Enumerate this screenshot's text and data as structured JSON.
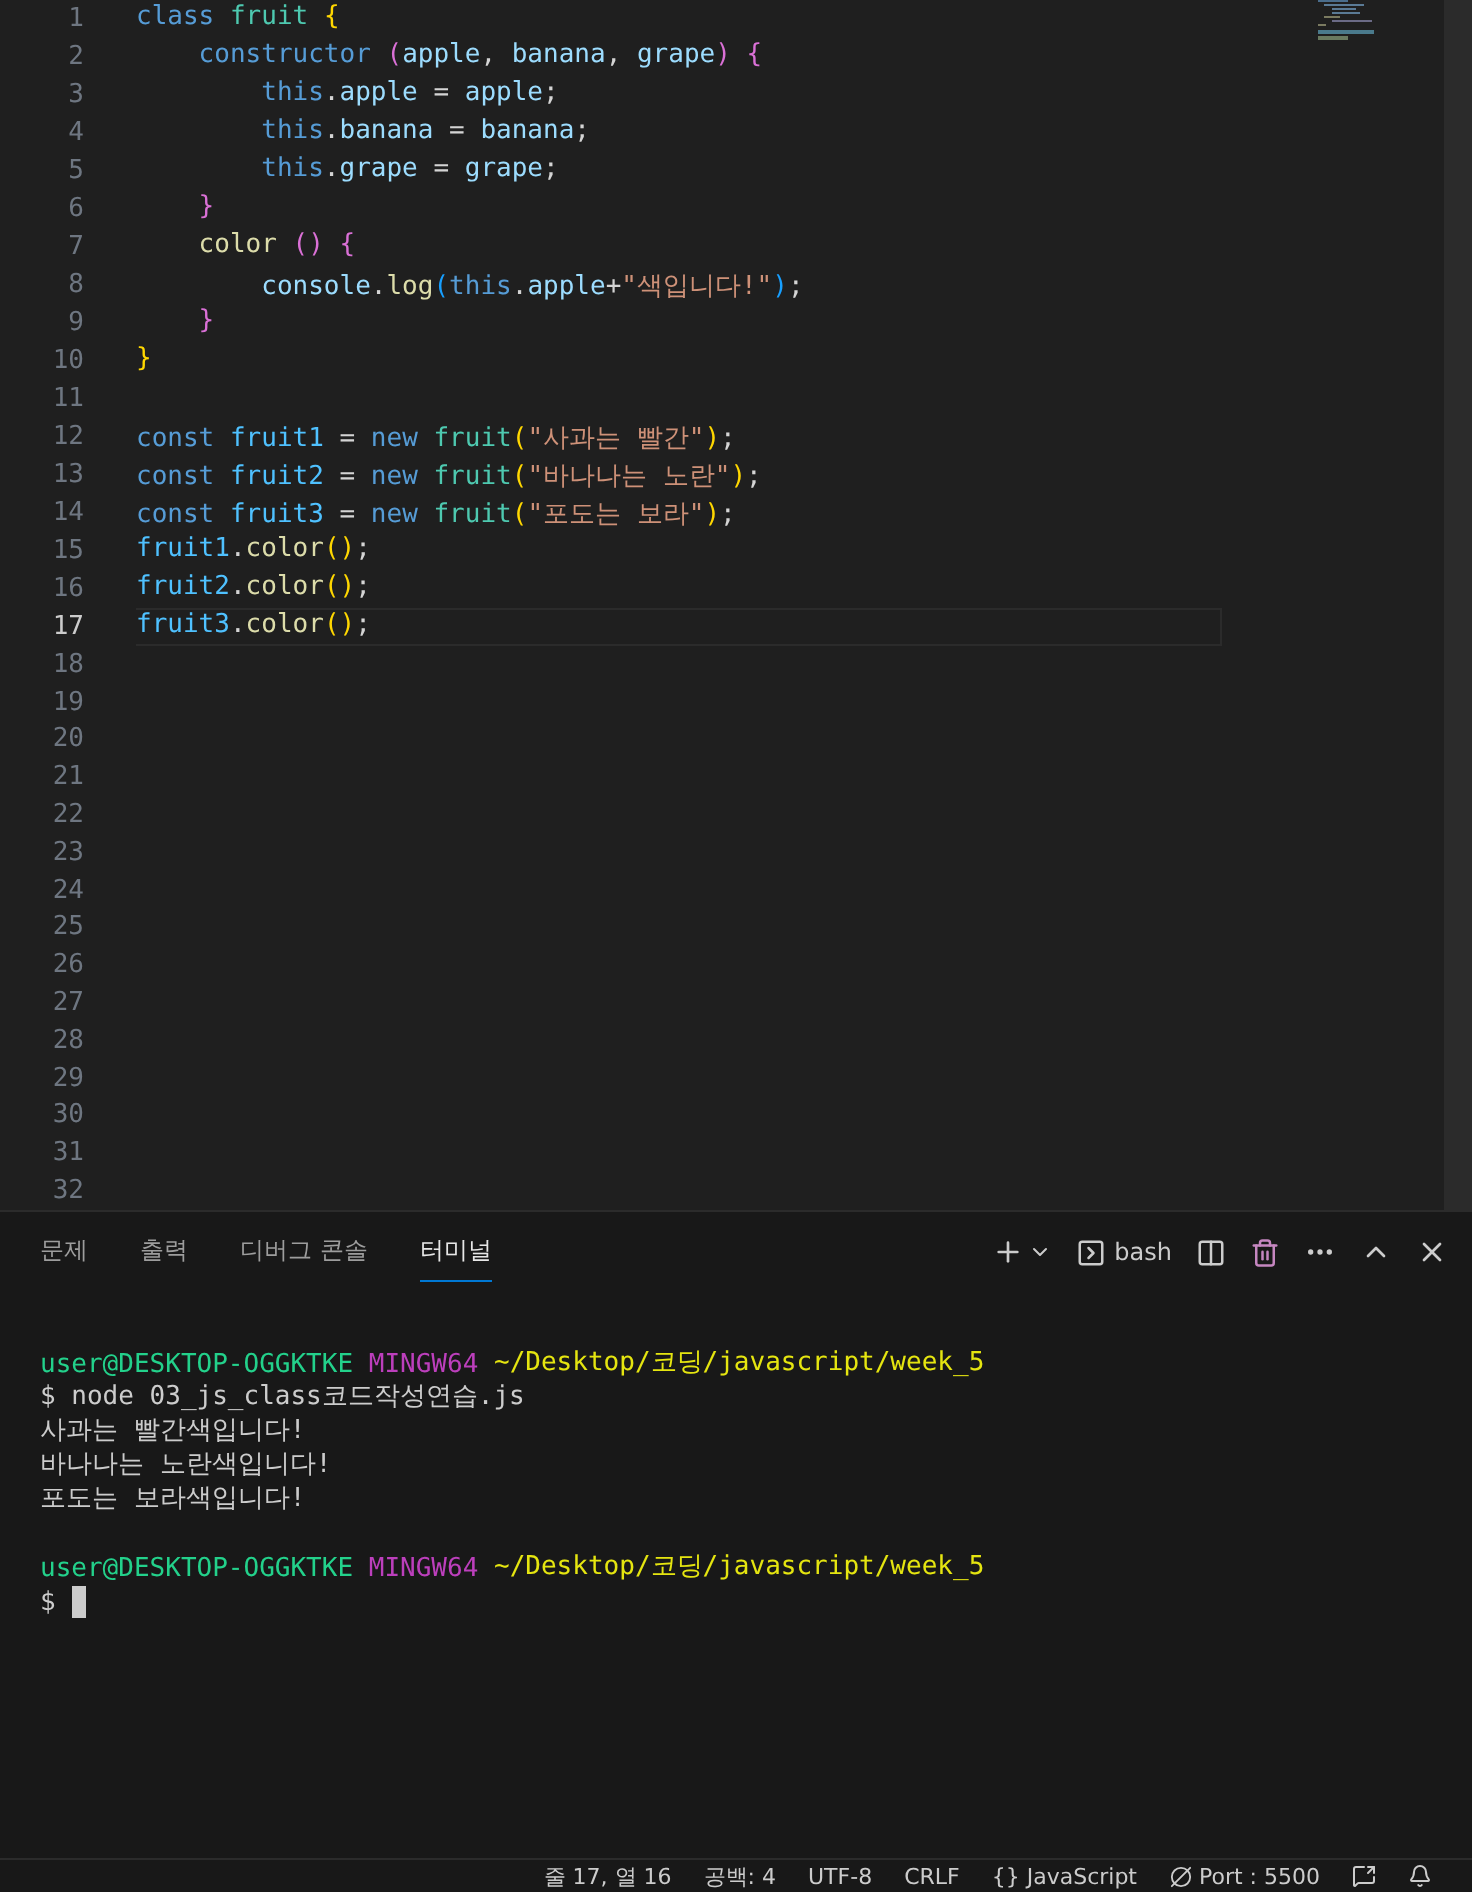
{
  "editor": {
    "lines": [
      {
        "number": "1",
        "active": false,
        "tokens": [
          {
            "kind": "keyword",
            "text": "class "
          },
          {
            "kind": "type",
            "text": "fruit "
          },
          {
            "kind": "bracket1",
            "text": "{"
          }
        ]
      },
      {
        "number": "2",
        "active": false,
        "tokens": [
          {
            "kind": "keyword",
            "text": "    constructor "
          },
          {
            "kind": "bracket2",
            "text": "("
          },
          {
            "kind": "variable",
            "text": "apple"
          },
          {
            "kind": "plain",
            "text": ", "
          },
          {
            "kind": "variable",
            "text": "banana"
          },
          {
            "kind": "plain",
            "text": ", "
          },
          {
            "kind": "variable",
            "text": "grape"
          },
          {
            "kind": "bracket2",
            "text": ") "
          },
          {
            "kind": "bracket2",
            "text": "{"
          }
        ]
      },
      {
        "number": "3",
        "active": false,
        "tokens": [
          {
            "kind": "keyword",
            "text": "        this"
          },
          {
            "kind": "plain",
            "text": "."
          },
          {
            "kind": "variable",
            "text": "apple"
          },
          {
            "kind": "plain",
            "text": " = "
          },
          {
            "kind": "variable",
            "text": "apple"
          },
          {
            "kind": "plain",
            "text": ";"
          }
        ]
      },
      {
        "number": "4",
        "active": false,
        "tokens": [
          {
            "kind": "keyword",
            "text": "        this"
          },
          {
            "kind": "plain",
            "text": "."
          },
          {
            "kind": "variable",
            "text": "banana"
          },
          {
            "kind": "plain",
            "text": " = "
          },
          {
            "kind": "variable",
            "text": "banana"
          },
          {
            "kind": "plain",
            "text": ";"
          }
        ]
      },
      {
        "number": "5",
        "active": false,
        "tokens": [
          {
            "kind": "keyword",
            "text": "        this"
          },
          {
            "kind": "plain",
            "text": "."
          },
          {
            "kind": "variable",
            "text": "grape"
          },
          {
            "kind": "plain",
            "text": " = "
          },
          {
            "kind": "variable",
            "text": "grape"
          },
          {
            "kind": "plain",
            "text": ";"
          }
        ]
      },
      {
        "number": "6",
        "active": false,
        "tokens": [
          {
            "kind": "bracket2",
            "text": "    }"
          }
        ]
      },
      {
        "number": "7",
        "active": false,
        "tokens": [
          {
            "kind": "function",
            "text": "    color "
          },
          {
            "kind": "bracket2",
            "text": "() "
          },
          {
            "kind": "bracket2",
            "text": "{"
          }
        ]
      },
      {
        "number": "8",
        "active": false,
        "tokens": [
          {
            "kind": "variable",
            "text": "        console"
          },
          {
            "kind": "plain",
            "text": "."
          },
          {
            "kind": "function",
            "text": "log"
          },
          {
            "kind": "bracket3",
            "text": "("
          },
          {
            "kind": "keyword",
            "text": "this"
          },
          {
            "kind": "plain",
            "text": "."
          },
          {
            "kind": "variable",
            "text": "apple"
          },
          {
            "kind": "plain",
            "text": "+"
          },
          {
            "kind": "string",
            "text": "\"색입니다!\""
          },
          {
            "kind": "bracket3",
            "text": ")"
          },
          {
            "kind": "plain",
            "text": ";"
          }
        ]
      },
      {
        "number": "9",
        "active": false,
        "tokens": [
          {
            "kind": "bracket2",
            "text": "    }"
          }
        ]
      },
      {
        "number": "10",
        "active": false,
        "tokens": [
          {
            "kind": "bracket1",
            "text": "}"
          }
        ]
      },
      {
        "number": "11",
        "active": false
      },
      {
        "number": "12",
        "active": false,
        "tokens": [
          {
            "kind": "keyword",
            "text": "const "
          },
          {
            "kind": "constant",
            "text": "fruit1"
          },
          {
            "kind": "plain",
            "text": " = "
          },
          {
            "kind": "keyword",
            "text": "new "
          },
          {
            "kind": "type",
            "text": "fruit"
          },
          {
            "kind": "bracket1",
            "text": "("
          },
          {
            "kind": "string",
            "text": "\"사과는 빨간\""
          },
          {
            "kind": "bracket1",
            "text": ")"
          },
          {
            "kind": "plain",
            "text": ";"
          }
        ]
      },
      {
        "number": "13",
        "active": false,
        "tokens": [
          {
            "kind": "keyword",
            "text": "const "
          },
          {
            "kind": "constant",
            "text": "fruit2"
          },
          {
            "kind": "plain",
            "text": " = "
          },
          {
            "kind": "keyword",
            "text": "new "
          },
          {
            "kind": "type",
            "text": "fruit"
          },
          {
            "kind": "bracket1",
            "text": "("
          },
          {
            "kind": "string",
            "text": "\"바나나는 노란\""
          },
          {
            "kind": "bracket1",
            "text": ")"
          },
          {
            "kind": "plain",
            "text": ";"
          }
        ]
      },
      {
        "number": "14",
        "active": false,
        "tokens": [
          {
            "kind": "keyword",
            "text": "const "
          },
          {
            "kind": "constant",
            "text": "fruit3"
          },
          {
            "kind": "plain",
            "text": " = "
          },
          {
            "kind": "keyword",
            "text": "new "
          },
          {
            "kind": "type",
            "text": "fruit"
          },
          {
            "kind": "bracket1",
            "text": "("
          },
          {
            "kind": "string",
            "text": "\"포도는 보라\""
          },
          {
            "kind": "bracket1",
            "text": ")"
          },
          {
            "kind": "plain",
            "text": ";"
          }
        ]
      },
      {
        "number": "15",
        "active": false,
        "tokens": [
          {
            "kind": "constant",
            "text": "fruit1"
          },
          {
            "kind": "plain",
            "text": "."
          },
          {
            "kind": "function",
            "text": "color"
          },
          {
            "kind": "bracket1",
            "text": "()"
          },
          {
            "kind": "plain",
            "text": ";"
          }
        ]
      },
      {
        "number": "16",
        "active": false,
        "tokens": [
          {
            "kind": "constant",
            "text": "fruit2"
          },
          {
            "kind": "plain",
            "text": "."
          },
          {
            "kind": "function",
            "text": "color"
          },
          {
            "kind": "bracket1",
            "text": "()"
          },
          {
            "kind": "plain",
            "text": ";"
          }
        ]
      },
      {
        "number": "17",
        "active": true,
        "tokens": [
          {
            "kind": "constant",
            "text": "fruit3"
          },
          {
            "kind": "plain",
            "text": "."
          },
          {
            "kind": "function",
            "text": "color"
          },
          {
            "kind": "bracket1",
            "text": "()"
          },
          {
            "kind": "plain",
            "text": ";"
          }
        ]
      },
      {
        "number": "18",
        "active": false
      },
      {
        "number": "19",
        "active": false
      },
      {
        "number": "20",
        "active": false
      },
      {
        "number": "21",
        "active": false
      },
      {
        "number": "22",
        "active": false
      },
      {
        "number": "23",
        "active": false
      },
      {
        "number": "24",
        "active": false
      },
      {
        "number": "25",
        "active": false
      },
      {
        "number": "26",
        "active": false
      },
      {
        "number": "27",
        "active": false
      },
      {
        "number": "28",
        "active": false
      },
      {
        "number": "29",
        "active": false
      },
      {
        "number": "30",
        "active": false
      },
      {
        "number": "31",
        "active": false
      },
      {
        "number": "32",
        "active": false
      }
    ]
  },
  "panel": {
    "tabs": [
      {
        "label": "문제",
        "selected": false
      },
      {
        "label": "출력",
        "selected": false
      },
      {
        "label": "디버그 콘솔",
        "selected": false
      },
      {
        "label": "터미널",
        "selected": true
      }
    ],
    "shell": "bash"
  },
  "terminal": {
    "lines": [
      {
        "gap_before": true,
        "segments": [
          {
            "kind": "user",
            "text": "user@DESKTOP-OGGKTKE "
          },
          {
            "kind": "host",
            "text": "MINGW64 "
          },
          {
            "kind": "path",
            "text": "~/Desktop/코딩/javascript/week_5"
          }
        ]
      },
      {
        "segments": [
          {
            "kind": "plain",
            "text": "$ node 03_js_class코드작성연습.js"
          }
        ]
      },
      {
        "segments": [
          {
            "kind": "plain",
            "text": "사과는 빨간색입니다!"
          }
        ]
      },
      {
        "segments": [
          {
            "kind": "plain",
            "text": "바나나는 노란색입니다!"
          }
        ]
      },
      {
        "segments": [
          {
            "kind": "plain",
            "text": "포도는 보라색입니다!"
          }
        ]
      },
      {
        "gap_before": true,
        "segments": [
          {
            "kind": "user",
            "text": "user@DESKTOP-OGGKTKE "
          },
          {
            "kind": "host",
            "text": "MINGW64 "
          },
          {
            "kind": "path",
            "text": "~/Desktop/코딩/javascript/week_5"
          }
        ]
      },
      {
        "segments": [
          {
            "kind": "plain",
            "text": "$ "
          }
        ],
        "cursor": true
      }
    ]
  },
  "status_bar": {
    "items": [
      "줄 17, 열 16",
      "공백: 4",
      "UTF-8",
      "CRLF",
      "{} JavaScript",
      "Port : 5500"
    ]
  }
}
